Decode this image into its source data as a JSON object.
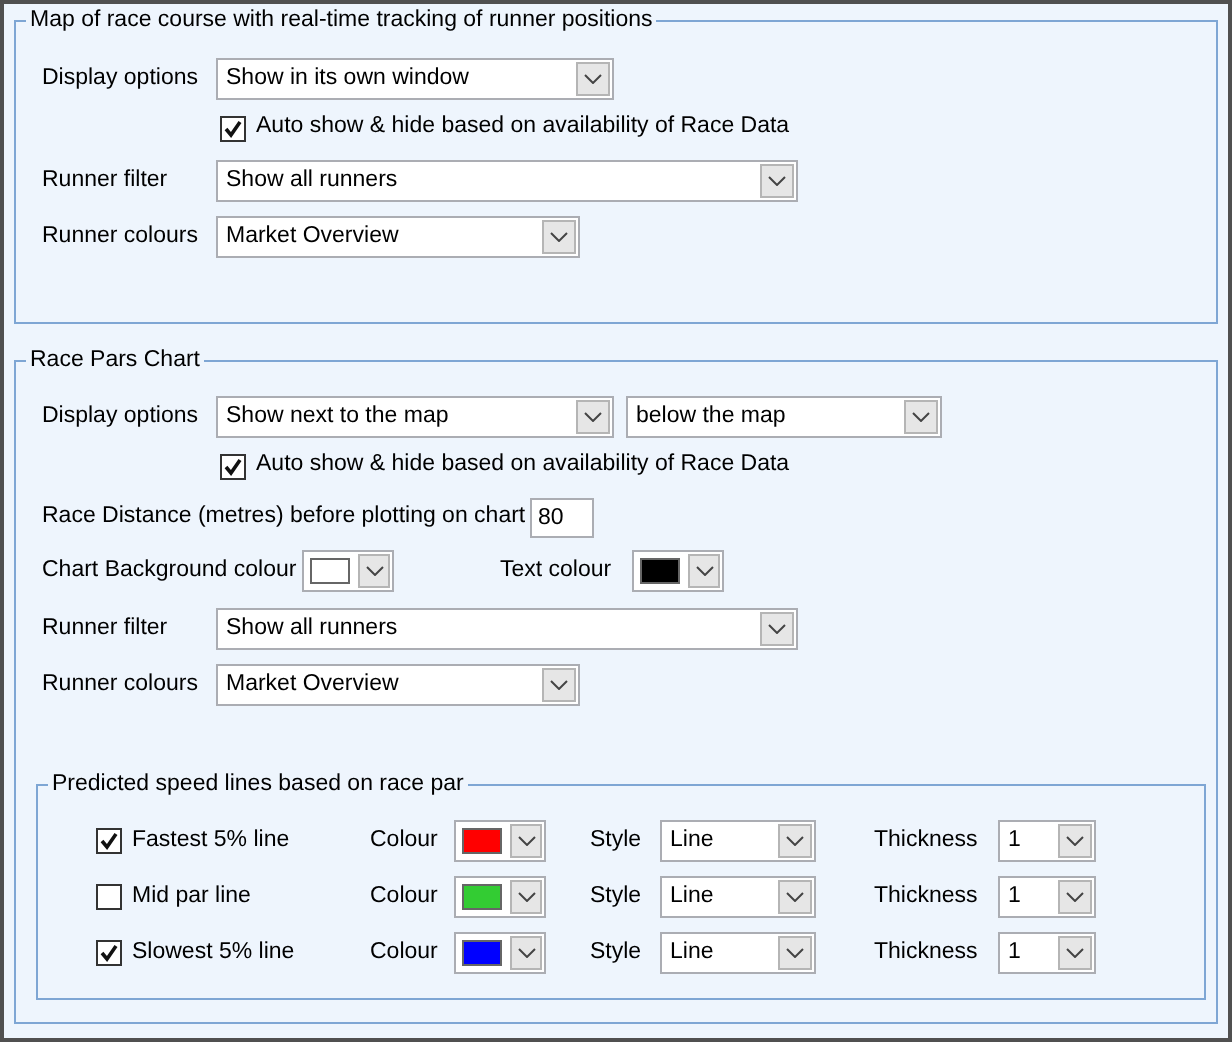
{
  "map_group": {
    "title": "Map of race course with real-time tracking of runner positions",
    "display_options": {
      "label": "Display options",
      "value": "Show in its own window"
    },
    "auto_show": {
      "label": "Auto show & hide based on availability of Race Data",
      "checked": true
    },
    "runner_filter": {
      "label": "Runner filter",
      "value": "Show all runners"
    },
    "runner_colours": {
      "label": "Runner colours",
      "value": "Market Overview"
    }
  },
  "race_pars_group": {
    "title": "Race Pars Chart",
    "display_options": {
      "label": "Display options",
      "value": "Show next to the map",
      "position": "below the map"
    },
    "auto_show": {
      "label": "Auto show & hide based on availability of Race Data",
      "checked": true
    },
    "race_distance": {
      "label": "Race Distance (metres) before plotting on chart",
      "value": "80"
    },
    "chart_background_colour": {
      "label": "Chart Background colour",
      "color": "#ffffff"
    },
    "text_colour": {
      "label": "Text colour",
      "color": "#000000"
    },
    "runner_filter": {
      "label": "Runner filter",
      "value": "Show all runners"
    },
    "runner_colours": {
      "label": "Runner colours",
      "value": "Market Overview"
    },
    "speed_lines": {
      "title": "Predicted speed lines based on race par",
      "lines": [
        {
          "label": "Fastest 5% line",
          "checked": true,
          "colour_label": "Colour",
          "color": "#ff0000",
          "style_label": "Style",
          "style": "Line",
          "thickness_label": "Thickness",
          "thickness": "1"
        },
        {
          "label": "Mid par line",
          "checked": false,
          "colour_label": "Colour",
          "color": "#33cc33",
          "style_label": "Style",
          "style": "Line",
          "thickness_label": "Thickness",
          "thickness": "1"
        },
        {
          "label": "Slowest 5% line",
          "checked": true,
          "colour_label": "Colour",
          "color": "#0000ff",
          "style_label": "Style",
          "style": "Line",
          "thickness_label": "Thickness",
          "thickness": "1"
        }
      ]
    }
  }
}
